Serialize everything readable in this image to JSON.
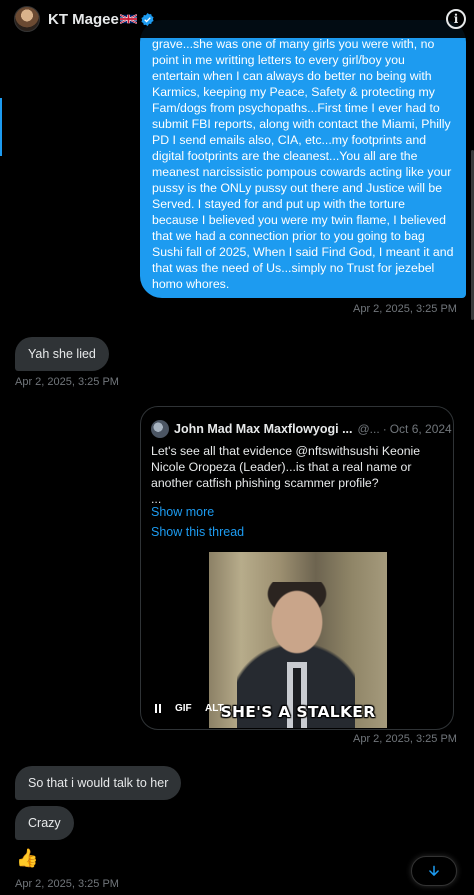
{
  "header": {
    "name": "KT Magee",
    "flag_icon": "uk-flag-icon",
    "verified_icon": "verified-badge-icon",
    "info_icon": "info-icon",
    "info_glyph": "i"
  },
  "colors": {
    "accent": "#1d9bf0",
    "bubble_in": "#2f3336",
    "background": "#000000",
    "muted": "#71767b"
  },
  "messages": [
    {
      "id": "outgoing-1",
      "text": "grave...she was one of many girls you were with, no point in me writting letters to every girl/boy you entertain when I can always do better no being with Karmics, keeping my Peace, Safety & protecting my Fam/dogs from psychopaths...First time I ever had to submit FBI reports, along with contact the Miami, Philly PD I send emails also, CIA, etc...my footprints and digital footprints are the cleanest...You all are the meanest narcissistic pompous cowards acting like your pussy is the ONLy pussy out there and Justice will be Served. I stayed for and put up with the torture because I believed you were my twin flame, I believed that we had a connection prior to you going to bag Sushi fall of 2025, When I said Find God, I meant it and that was the need of Us...simply no Trust for jezebel homo whores.",
      "timestamp": "Apr 2, 2025, 3:25 PM"
    },
    {
      "id": "incoming-1",
      "text": "Yah she lied",
      "timestamp": "Apr 2, 2025, 3:25 PM"
    },
    {
      "id": "outgoing-quote",
      "quote": {
        "author": "John Mad Max Maxflowyogi ...",
        "handle": "@...",
        "dot": "·",
        "date": "Oct 6, 2024",
        "text": "Let's see all that evidence @nftswithsushi Keonie Nicole Oropeza (Leader)...is that a real name or another catfish phishing scammer profile?",
        "ellipsis": "...",
        "show_more": "Show more",
        "show_thread": "Show this thread",
        "media_caption": "SHE'S A STALKER",
        "gif_label": "GIF",
        "alt_label": "ALT"
      },
      "timestamp": "Apr 2, 2025, 3:25 PM"
    },
    {
      "id": "incoming-2",
      "text": "So that i would talk to her"
    },
    {
      "id": "incoming-3",
      "text": "Crazy"
    },
    {
      "id": "incoming-4",
      "emoji": "👍",
      "timestamp": "Apr 2, 2025, 3:25 PM"
    }
  ],
  "scroll_down_icon": "arrow-down-icon"
}
